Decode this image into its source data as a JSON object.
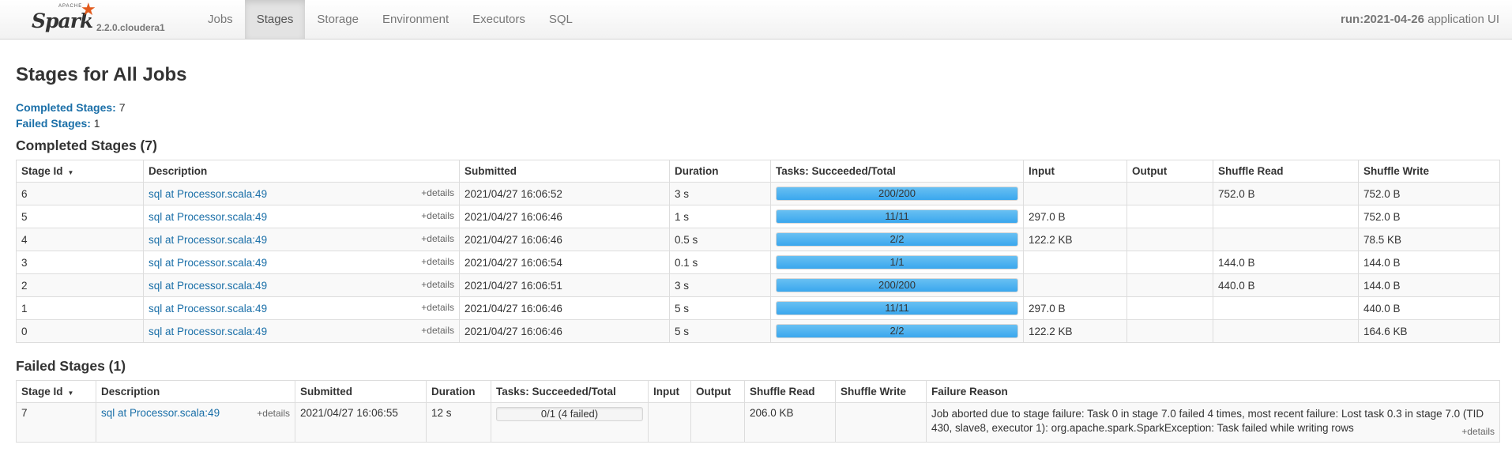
{
  "brand": {
    "apache": "APACHE",
    "name": "Spark",
    "version": "2.2.0.cloudera1"
  },
  "nav": [
    {
      "label": "Jobs"
    },
    {
      "label": "Stages",
      "active": true
    },
    {
      "label": "Storage"
    },
    {
      "label": "Environment"
    },
    {
      "label": "Executors"
    },
    {
      "label": "SQL"
    }
  ],
  "app": {
    "name": "run:2021-04-26",
    "suffix": " application UI"
  },
  "page": {
    "title": "Stages for All Jobs"
  },
  "summary": {
    "completed_label": "Completed Stages:",
    "completed_count": " 7",
    "failed_label": "Failed Stages:",
    "failed_count": " 1"
  },
  "completed": {
    "title": "Completed Stages (7)",
    "headers": [
      "Stage Id",
      "Description",
      "Submitted",
      "Duration",
      "Tasks: Succeeded/Total",
      "Input",
      "Output",
      "Shuffle Read",
      "Shuffle Write"
    ],
    "rows": [
      {
        "id": "6",
        "desc": "sql at Processor.scala:49",
        "details": "+details",
        "submitted": "2021/04/27 16:06:52",
        "duration": "3 s",
        "tasks": "200/200",
        "progress": 1.0,
        "input": "",
        "output": "",
        "shuffle_read": "752.0 B",
        "shuffle_write": "752.0 B"
      },
      {
        "id": "5",
        "desc": "sql at Processor.scala:49",
        "details": "+details",
        "submitted": "2021/04/27 16:06:46",
        "duration": "1 s",
        "tasks": "11/11",
        "progress": 1.0,
        "input": "297.0 B",
        "output": "",
        "shuffle_read": "",
        "shuffle_write": "752.0 B"
      },
      {
        "id": "4",
        "desc": "sql at Processor.scala:49",
        "details": "+details",
        "submitted": "2021/04/27 16:06:46",
        "duration": "0.5 s",
        "tasks": "2/2",
        "progress": 1.0,
        "input": "122.2 KB",
        "output": "",
        "shuffle_read": "",
        "shuffle_write": "78.5 KB"
      },
      {
        "id": "3",
        "desc": "sql at Processor.scala:49",
        "details": "+details",
        "submitted": "2021/04/27 16:06:54",
        "duration": "0.1 s",
        "tasks": "1/1",
        "progress": 1.0,
        "input": "",
        "output": "",
        "shuffle_read": "144.0 B",
        "shuffle_write": "144.0 B"
      },
      {
        "id": "2",
        "desc": "sql at Processor.scala:49",
        "details": "+details",
        "submitted": "2021/04/27 16:06:51",
        "duration": "3 s",
        "tasks": "200/200",
        "progress": 1.0,
        "input": "",
        "output": "",
        "shuffle_read": "440.0 B",
        "shuffle_write": "144.0 B"
      },
      {
        "id": "1",
        "desc": "sql at Processor.scala:49",
        "details": "+details",
        "submitted": "2021/04/27 16:06:46",
        "duration": "5 s",
        "tasks": "11/11",
        "progress": 1.0,
        "input": "297.0 B",
        "output": "",
        "shuffle_read": "",
        "shuffle_write": "440.0 B"
      },
      {
        "id": "0",
        "desc": "sql at Processor.scala:49",
        "details": "+details",
        "submitted": "2021/04/27 16:06:46",
        "duration": "5 s",
        "tasks": "2/2",
        "progress": 1.0,
        "input": "122.2 KB",
        "output": "",
        "shuffle_read": "",
        "shuffle_write": "164.6 KB"
      }
    ]
  },
  "failed": {
    "title": "Failed Stages (1)",
    "headers": [
      "Stage Id",
      "Description",
      "Submitted",
      "Duration",
      "Tasks: Succeeded/Total",
      "Input",
      "Output",
      "Shuffle Read",
      "Shuffle Write",
      "Failure Reason"
    ],
    "rows": [
      {
        "id": "7",
        "desc": "sql at Processor.scala:49",
        "details": "+details",
        "submitted": "2021/04/27 16:06:55",
        "duration": "12 s",
        "tasks": "0/1 (4 failed)",
        "progress": 0.0,
        "input": "",
        "output": "",
        "shuffle_read": "206.0 KB",
        "shuffle_write": "",
        "reason": "Job aborted due to stage failure: Task 0 in stage 7.0 failed 4 times, most recent failure: Lost task 0.3 in stage 7.0 (TID 430, slave8, executor 1): org.apache.spark.SparkException: Task failed while writing rows",
        "reason_details": "+details"
      }
    ]
  }
}
